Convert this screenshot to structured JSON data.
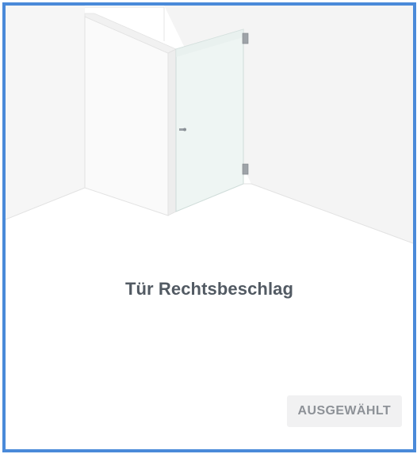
{
  "option": {
    "title": "Tür Rechtsbeschlag",
    "button_label": "AUSGEWÄHLT",
    "illustration_icon": "shower-door-right-hinge-illustration"
  },
  "colors": {
    "card_border": "#4a8ad9",
    "title_text": "#525a63",
    "button_background": "#f1f1f2",
    "button_text": "#8d9197"
  }
}
